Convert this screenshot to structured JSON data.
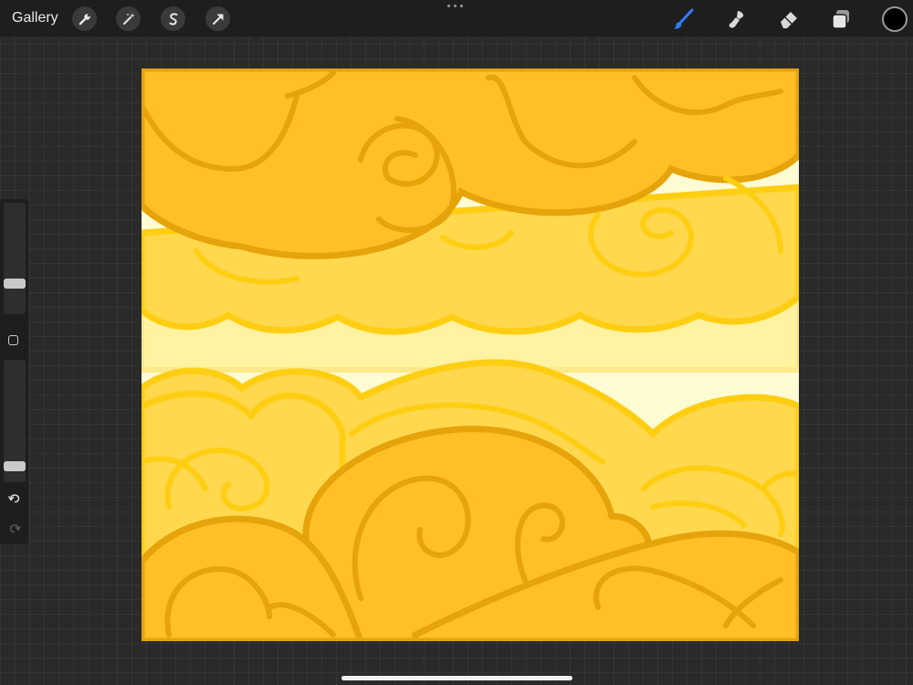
{
  "toolbar": {
    "gallery_label": "Gallery",
    "left_tools": [
      "wrench-icon",
      "magic-wand-icon",
      "selection-icon",
      "transform-arrow-icon"
    ],
    "right_tools": [
      "brush-icon",
      "smudge-icon",
      "eraser-icon",
      "layers-icon"
    ],
    "active_tool": "brush-icon",
    "active_tool_color": "#2f7cf6",
    "current_color": "#000000"
  },
  "sidebar": {
    "brush_size_level": 0.25,
    "opacity_level": 0.1
  },
  "canvas": {
    "colors": [
      "#ffbf26",
      "#e6a30a",
      "#ffd84e",
      "#ffce12",
      "#fff2a0",
      "#fffbd2"
    ]
  }
}
